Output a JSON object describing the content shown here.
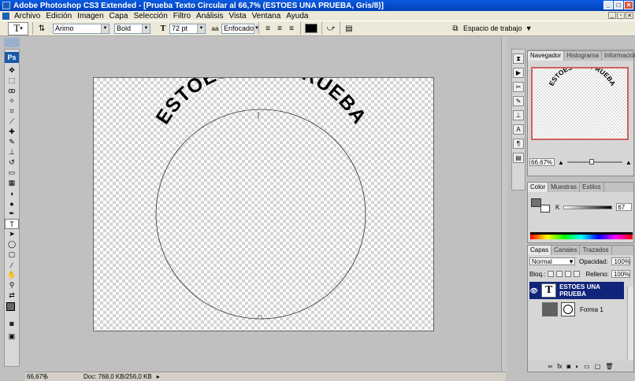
{
  "window": {
    "title": "Adobe Photoshop CS3 Extended - [Prueba Texto Circular al 66,7% (ESTOES UNA PRUEBA, Gris/8)]"
  },
  "menu": [
    "Archivo",
    "Edición",
    "Imagen",
    "Capa",
    "Selección",
    "Filtro",
    "Análisis",
    "Vista",
    "Ventana",
    "Ayuda"
  ],
  "options": {
    "font_family": "Arimo",
    "font_style": "Bold",
    "font_size": "72 pt",
    "antialias": "Enfocado",
    "workspace": "Espacio de trabajo"
  },
  "canvas": {
    "arc_text": "ESTOES UNA PRUEBA"
  },
  "status": {
    "zoom": "66,67%",
    "doc": "Doc: 768,0 KB/256,0 KB"
  },
  "panels": {
    "navigator_tabs": [
      "Navegador",
      "Histograma",
      "Información"
    ],
    "navigator_zoom": "66,67%",
    "color_tabs": [
      "Color",
      "Muestras",
      "Estilos"
    ],
    "color_channel": "K",
    "color_value": "67",
    "layers_tabs": [
      "Capas",
      "Canales",
      "Trazados"
    ],
    "blend_mode": "Normal",
    "opacity_label": "Opacidad:",
    "opacity_value": "100%",
    "lock_label": "Bloq.:",
    "fill_label": "Relleno:",
    "fill_value": "100%",
    "layers": [
      {
        "name": "ESTOES UNA PRUEBA",
        "type": "text",
        "selected": true
      },
      {
        "name": "Forma 1",
        "type": "shape",
        "selected": false
      }
    ]
  },
  "colors": {
    "selected_layer": "#10247a",
    "title_bar": "#0a5ae0"
  }
}
